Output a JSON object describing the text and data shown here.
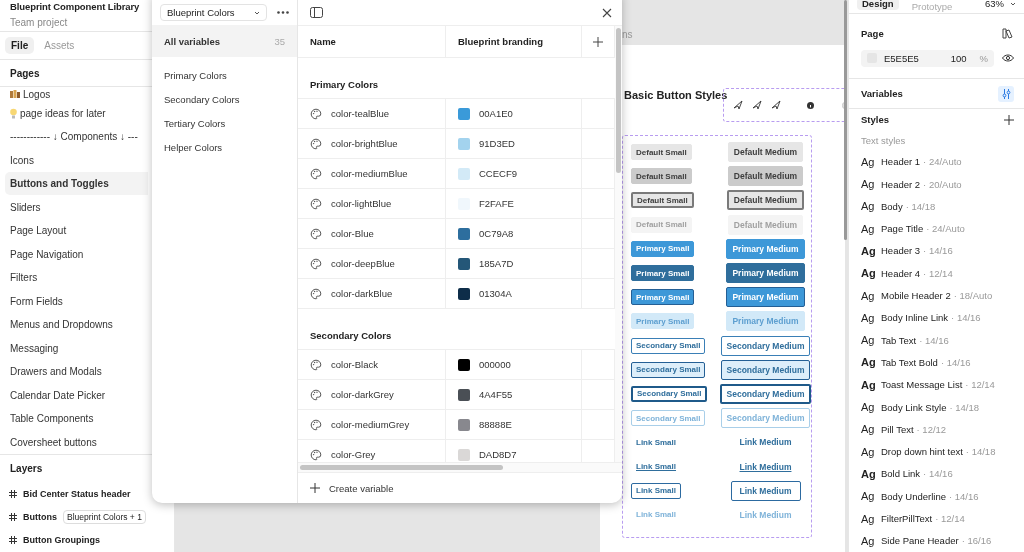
{
  "left_panel": {
    "file_title": "Blueprint Component Library",
    "subtitle": "Team project",
    "tabs": [
      {
        "label": "File",
        "selected": true
      },
      {
        "label": "Assets",
        "selected": false
      }
    ],
    "pages_heading": "Pages",
    "pages": [
      {
        "label": "Logos",
        "kind": "books",
        "selected": false
      },
      {
        "label": "page ideas for later",
        "kind": "bulb",
        "selected": false
      },
      {
        "label": "------------ ↓ Components ↓ ---",
        "kind": "plain",
        "selected": false
      },
      {
        "label": "Icons",
        "kind": "plain",
        "selected": false
      },
      {
        "label": "Buttons and Toggles",
        "kind": "plain",
        "selected": true
      },
      {
        "label": "Sliders",
        "kind": "plain",
        "selected": false
      },
      {
        "label": "Page Layout",
        "kind": "plain",
        "selected": false
      },
      {
        "label": "Page Navigation",
        "kind": "plain",
        "selected": false
      },
      {
        "label": "Filters",
        "kind": "plain",
        "selected": false
      },
      {
        "label": "Form Fields",
        "kind": "plain",
        "selected": false
      },
      {
        "label": "Menus and Dropdowns",
        "kind": "plain",
        "selected": false
      },
      {
        "label": "Messaging",
        "kind": "plain",
        "selected": false
      },
      {
        "label": "Drawers and Modals",
        "kind": "plain",
        "selected": false
      },
      {
        "label": "Calendar Date Picker",
        "kind": "plain",
        "selected": false
      },
      {
        "label": "Table Components",
        "kind": "plain",
        "selected": false
      },
      {
        "label": "Coversheet buttons",
        "kind": "plain",
        "selected": false
      }
    ],
    "layers_heading": "Layers",
    "layers": [
      {
        "name": "Bid Center Status header"
      },
      {
        "name": "Buttons",
        "badge": "Blueprint Colors + 1"
      },
      {
        "name": "Button Groupings"
      }
    ]
  },
  "variables_dialog": {
    "collection": "Blueprint Colors",
    "collections": [
      {
        "label": "All variables",
        "count": "35",
        "selected": true
      },
      {
        "label": "Primary Colors",
        "selected": false
      },
      {
        "label": "Secondary Colors",
        "selected": false
      },
      {
        "label": "Tertiary Colors",
        "selected": false
      },
      {
        "label": "Helper Colors",
        "selected": false
      }
    ],
    "columns": [
      "Name",
      "Blueprint branding"
    ],
    "groups": [
      {
        "title": "Primary Colors",
        "variables": [
          {
            "name": "color-tealBlue",
            "value": "00A1E0",
            "color": "#3a9ad9"
          },
          {
            "name": "color-brightBlue",
            "value": "91D3ED",
            "color": "#a3d3ee"
          },
          {
            "name": "color-mediumBlue",
            "value": "CCECF9",
            "color": "#d3eaf7"
          },
          {
            "name": "color-lightBlue",
            "value": "F2FAFE",
            "color": "#f0f7fc"
          },
          {
            "name": "color-Blue",
            "value": "0C79A8",
            "color": "#2d6e9e"
          },
          {
            "name": "color-deepBlue",
            "value": "185A7D",
            "color": "#245778"
          },
          {
            "name": "color-darkBlue",
            "value": "01304A",
            "color": "#0e2d49"
          }
        ]
      },
      {
        "title": "Secondary Colors",
        "variables": [
          {
            "name": "color-Black",
            "value": "000000",
            "color": "#000000"
          },
          {
            "name": "color-darkGrey",
            "value": "4A4F55",
            "color": "#4a4f55"
          },
          {
            "name": "color-mediumGrey",
            "value": "88888E",
            "color": "#88888e"
          },
          {
            "name": "color-Grey",
            "value": "DAD8D7",
            "color": "#dad8d7"
          }
        ]
      }
    ],
    "create_label": "Create variable"
  },
  "canvas": {
    "frame_label": "ns",
    "section_title": "Basic Button Styles",
    "button_rows": [
      {
        "kind": "default",
        "hovered": false,
        "pressed": false,
        "disabled": false,
        "small": "Default Small",
        "medium": "Default Medium"
      },
      {
        "kind": "default",
        "hovered": true,
        "pressed": false,
        "disabled": false,
        "small": "Default Small",
        "medium": "Default Medium"
      },
      {
        "kind": "default",
        "hovered": false,
        "pressed": true,
        "disabled": false,
        "small": "Default Small",
        "medium": "Default Medium"
      },
      {
        "kind": "default",
        "hovered": false,
        "pressed": false,
        "disabled": true,
        "small": "Default Small",
        "medium": "Default Medium"
      },
      {
        "kind": "primary",
        "hovered": false,
        "pressed": false,
        "disabled": false,
        "small": "Primary Small",
        "medium": "Primary Medium"
      },
      {
        "kind": "primary",
        "hovered": true,
        "pressed": false,
        "disabled": false,
        "small": "Primary Small",
        "medium": "Primary Medium"
      },
      {
        "kind": "primary",
        "hovered": false,
        "pressed": true,
        "disabled": false,
        "small": "Primary Small",
        "medium": "Primary Medium"
      },
      {
        "kind": "primary",
        "hovered": false,
        "pressed": false,
        "disabled": true,
        "small": "Primary Small",
        "medium": "Primary Medium"
      },
      {
        "kind": "secondary",
        "hovered": false,
        "pressed": false,
        "disabled": false,
        "small": "Secondary Small",
        "medium": "Secondary Medium"
      },
      {
        "kind": "secondary",
        "hovered": true,
        "pressed": false,
        "disabled": false,
        "small": "Secondary Small",
        "medium": "Secondary Medium"
      },
      {
        "kind": "secondary",
        "hovered": false,
        "pressed": true,
        "disabled": false,
        "small": "Secondary Small",
        "medium": "Secondary Medium"
      },
      {
        "kind": "secondary",
        "hovered": false,
        "pressed": false,
        "disabled": true,
        "small": "Secondary Small",
        "medium": "Secondary Medium"
      },
      {
        "kind": "link",
        "hovered": false,
        "pressed": false,
        "disabled": false,
        "small": "Link Small",
        "medium": "Link Medium"
      },
      {
        "kind": "link",
        "hovered": true,
        "pressed": false,
        "disabled": false,
        "small": "Link Small",
        "medium": "Link Medium"
      },
      {
        "kind": "link",
        "hovered": false,
        "pressed": true,
        "disabled": false,
        "small": "Link Small",
        "medium": "Link Medium"
      },
      {
        "kind": "link",
        "hovered": false,
        "pressed": false,
        "disabled": true,
        "small": "Link Small",
        "medium": "Link Medium"
      }
    ]
  },
  "right_panel": {
    "tabs": [
      {
        "label": "Design",
        "selected": true
      },
      {
        "label": "Prototype",
        "selected": false
      }
    ],
    "zoom": "63%",
    "page_heading": "Page",
    "page_color": {
      "value": "E5E5E5",
      "color": "#e5e5e5",
      "opacity": "100",
      "unit": "%"
    },
    "variables_heading": "Variables",
    "styles_heading": "Styles",
    "text_styles_heading": "Text styles",
    "text_styles": [
      {
        "sample": "Ag",
        "name": "Header 1",
        "spec": "· 24/Auto",
        "bold": false
      },
      {
        "sample": "Ag",
        "name": "Header 2",
        "spec": "· 20/Auto",
        "bold": false
      },
      {
        "sample": "Ag",
        "name": "Body",
        "spec": "· 14/18",
        "bold": false
      },
      {
        "sample": "Ag",
        "name": "Page Title",
        "spec": "· 24/Auto",
        "bold": false
      },
      {
        "sample": "Ag",
        "name": "Header 3",
        "spec": "· 14/16",
        "bold": true
      },
      {
        "sample": "Ag",
        "name": "Header 4",
        "spec": "· 12/14",
        "bold": true
      },
      {
        "sample": "Ag",
        "name": "Mobile Header 2",
        "spec": "· 18/Auto",
        "bold": false
      },
      {
        "sample": "Ag",
        "name": "Body Inline Link",
        "spec": "· 14/16",
        "bold": false
      },
      {
        "sample": "Ag",
        "name": "Tab Text",
        "spec": "· 14/16",
        "bold": false
      },
      {
        "sample": "Ag",
        "name": "Tab Text Bold",
        "spec": "· 14/16",
        "bold": true
      },
      {
        "sample": "Ag",
        "name": "Toast Message List",
        "spec": "· 12/14",
        "bold": true
      },
      {
        "sample": "Ag",
        "name": "Body Link Style",
        "spec": "· 14/18",
        "bold": false
      },
      {
        "sample": "Ag",
        "name": "Pill Text",
        "spec": "· 12/12",
        "bold": false
      },
      {
        "sample": "Ag",
        "name": "Drop down hint text",
        "spec": "· 14/18",
        "bold": false
      },
      {
        "sample": "Ag",
        "name": "Bold Link",
        "spec": "· 14/16",
        "bold": true
      },
      {
        "sample": "Ag",
        "name": "Body Underline",
        "spec": "· 14/16",
        "bold": false
      },
      {
        "sample": "Ag",
        "name": "FilterPillText",
        "spec": "· 12/14",
        "bold": false
      },
      {
        "sample": "Ag",
        "name": "Side Pane Header",
        "spec": "· 16/16",
        "bold": false
      }
    ]
  }
}
